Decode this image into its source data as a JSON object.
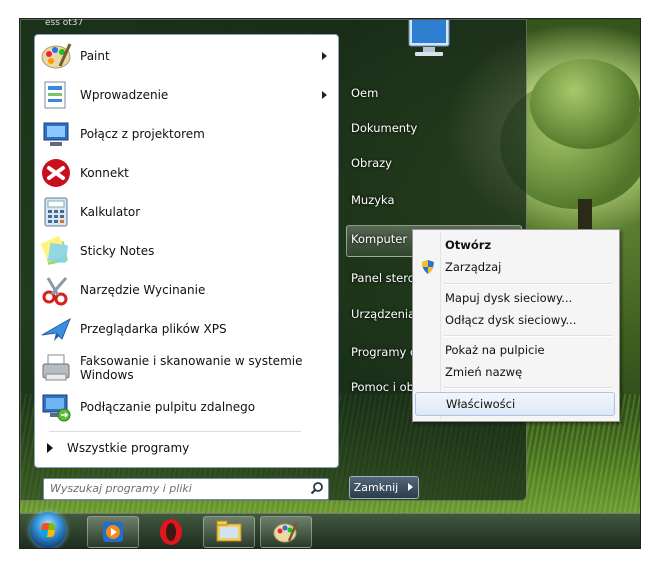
{
  "user_label": "ess ot37",
  "programs": [
    {
      "label": "Paint",
      "icon": "paint-icon",
      "submenu": true
    },
    {
      "label": "Wprowadzenie",
      "icon": "getting-started-icon",
      "submenu": true
    },
    {
      "label": "Połącz z projektorem",
      "icon": "projector-icon",
      "submenu": false
    },
    {
      "label": "Konnekt",
      "icon": "konnekt-icon",
      "submenu": false
    },
    {
      "label": "Kalkulator",
      "icon": "calculator-icon",
      "submenu": false
    },
    {
      "label": "Sticky Notes",
      "icon": "sticky-notes-icon",
      "submenu": false
    },
    {
      "label": "Narzędzie Wycinanie",
      "icon": "snipping-tool-icon",
      "submenu": false
    },
    {
      "label": "Przeglądarka plików XPS",
      "icon": "xps-viewer-icon",
      "submenu": false
    },
    {
      "label": "Faksowanie i skanowanie w systemie Windows",
      "icon": "fax-scan-icon",
      "submenu": false
    },
    {
      "label": "Podłączanie pulpitu zdalnego",
      "icon": "remote-desktop-icon",
      "submenu": false
    }
  ],
  "all_programs": "Wszystkie programy",
  "search_placeholder": "Wyszukaj programy i pliki",
  "right_items": [
    {
      "label": "Oem"
    },
    {
      "label": "Dokumenty"
    },
    {
      "label": "Obrazy"
    },
    {
      "label": "Muzyka"
    },
    {
      "label": "Komputer"
    },
    {
      "label": "Panel stero"
    },
    {
      "label": "Urządzenia"
    },
    {
      "label": "Programy d"
    },
    {
      "label": "Pomoc i ob"
    }
  ],
  "shutdown_label": "Zamknij",
  "context_menu": [
    {
      "label": "Otwórz",
      "bold": true
    },
    {
      "label": "Zarządzaj",
      "shield": true
    },
    {
      "label": "Mapuj dysk sieciowy..."
    },
    {
      "label": "Odłącz dysk sieciowy..."
    },
    {
      "label": "Pokaż na pulpicie"
    },
    {
      "label": "Zmień nazwę"
    },
    {
      "label": "Właściwości",
      "hovered": true
    }
  ],
  "taskbar": [
    {
      "name": "start-orb"
    },
    {
      "name": "media-center-icon"
    },
    {
      "name": "opera-icon"
    },
    {
      "name": "explorer-icon"
    },
    {
      "name": "paint-icon"
    }
  ],
  "colors": {
    "accent": "#3d9be0",
    "menu_hover_border": "#a8c4e6"
  }
}
